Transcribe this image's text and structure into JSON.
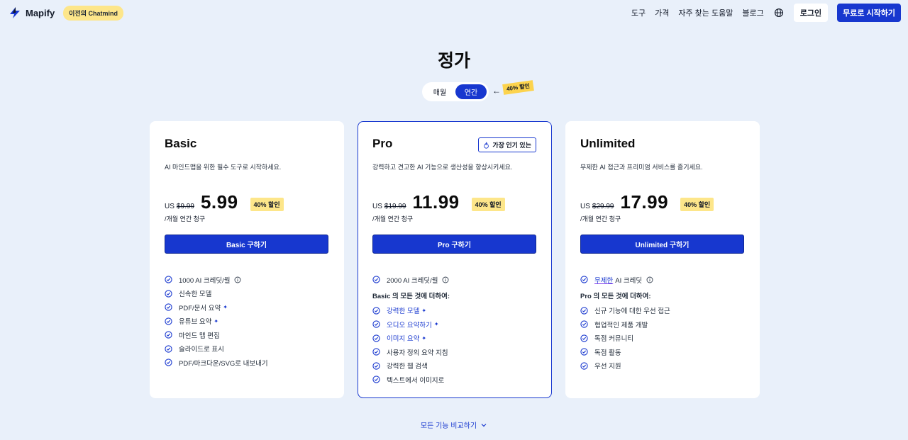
{
  "header": {
    "brand": "Mapify",
    "prev_badge": "이전의 Chatmind",
    "nav": [
      "도구",
      "가격",
      "자주 찾는 도움말",
      "블로그"
    ],
    "login": "로그인",
    "start": "무료로 시작하기"
  },
  "page_title": "정가",
  "toggle": {
    "monthly": "매월",
    "yearly": "연간",
    "discount": "40% 할인",
    "arrow": "←"
  },
  "plans": [
    {
      "name": "Basic",
      "desc": "AI 마인드맵을 위한 필수 도구로 시작하세요.",
      "prefix": "US",
      "old_price": "$9.99",
      "price": "5.99",
      "discount": "40% 할인",
      "billing": "/개월 연간 청구",
      "cta": "Basic 구하기",
      "features": [
        "1000 AI 크레딧/월",
        "신속한 모델",
        "PDF/문서 요약",
        "유튜브 요약",
        "마인드 맵 편집",
        "슬라이드로 표시",
        "PDF/마크다운/SVG로 내보내기"
      ]
    },
    {
      "name": "Pro",
      "popular": "가장 인기 있는",
      "desc": "강력하고 견고한 AI 기능으로 생산성을 향상시키세요.",
      "prefix": "US",
      "old_price": "$19.99",
      "price": "11.99",
      "discount": "40% 할인",
      "billing": "/개월 연간 청구",
      "cta": "Pro 구하기",
      "credit": "2000 AI 크레딧/월",
      "section": "Basic 의 모든 것에 더하여:",
      "features": [
        "강력한 모델",
        "오디오 요약하기",
        "이미지 요약",
        "사용자 정의 요약 지침",
        "강력한 웹 검색",
        "텍스트에서 이미지로"
      ]
    },
    {
      "name": "Unlimited",
      "desc": "무제한 AI 접근과 프리미엄 서비스를 즐기세요.",
      "prefix": "US",
      "old_price": "$29.99",
      "price": "17.99",
      "discount": "40% 할인",
      "billing": "/개월 연간 청구",
      "cta": "Unlimited 구하기",
      "credit_word": "무제한",
      "credit_rest": "AI 크레딧",
      "section": "Pro 의 모든 것에 더하여:",
      "features": [
        "신규 기능에 대한 우선 접근",
        "협업적인 제품 개발",
        "독점 커뮤니티",
        "독점 활동",
        "우선 지원"
      ]
    }
  ],
  "compare": "모든 기능 비교하기",
  "colors": {
    "accent": "#1737cf",
    "background": "#e9f0fa",
    "badge": "#fde68a"
  },
  "icons": {
    "logo": "bolt-icon",
    "globe": "globe-icon",
    "check": "check-circle-icon",
    "info": "info-icon",
    "fire": "fire-icon",
    "sparkle": "sparkle-icon",
    "chevron": "chevron-down-icon"
  }
}
